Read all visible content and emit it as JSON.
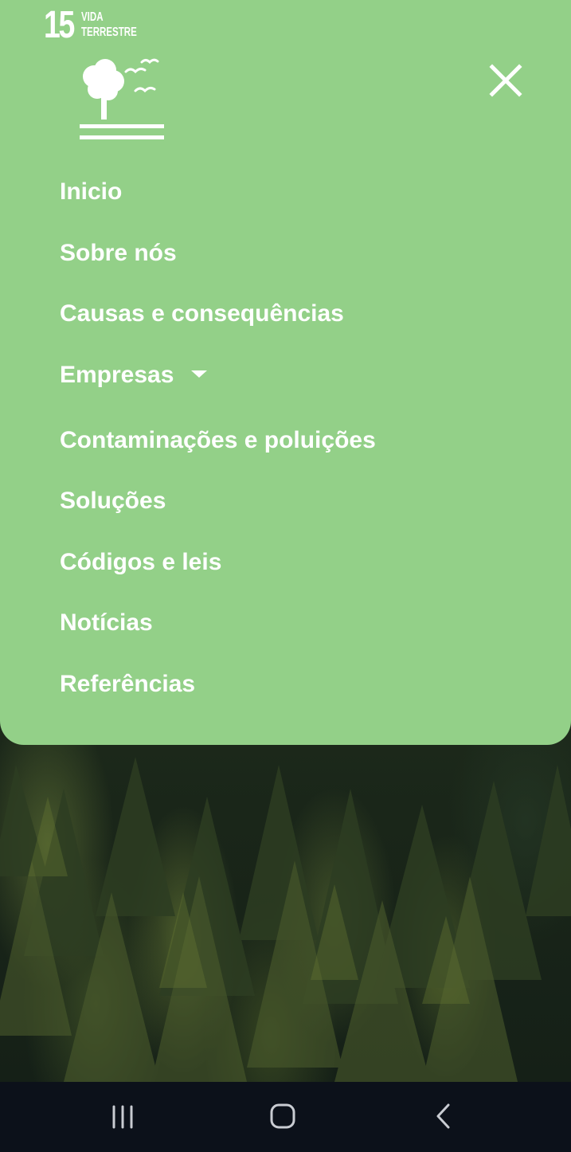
{
  "badge": {
    "number": "15",
    "line1": "VIDA",
    "line2": "TERRESTRE",
    "icon": "tree-birds-icon"
  },
  "close_icon": "close-icon",
  "nav": {
    "items": [
      {
        "label": "Inicio"
      },
      {
        "label": "Sobre nós"
      },
      {
        "label": "Causas e consequências"
      },
      {
        "label": "Empresas",
        "has_dropdown": true
      },
      {
        "label": "Contaminações e poluições"
      },
      {
        "label": "Soluções"
      },
      {
        "label": "Códigos e leis"
      },
      {
        "label": "Notícias"
      },
      {
        "label": "Referências"
      }
    ]
  },
  "system_nav": {
    "recents_icon": "recents-icon",
    "home_icon": "home-icon",
    "back_icon": "back-icon"
  },
  "colors": {
    "menu_bg": "#93d088",
    "text": "#ffffff",
    "system_bar": "#0c111a"
  }
}
